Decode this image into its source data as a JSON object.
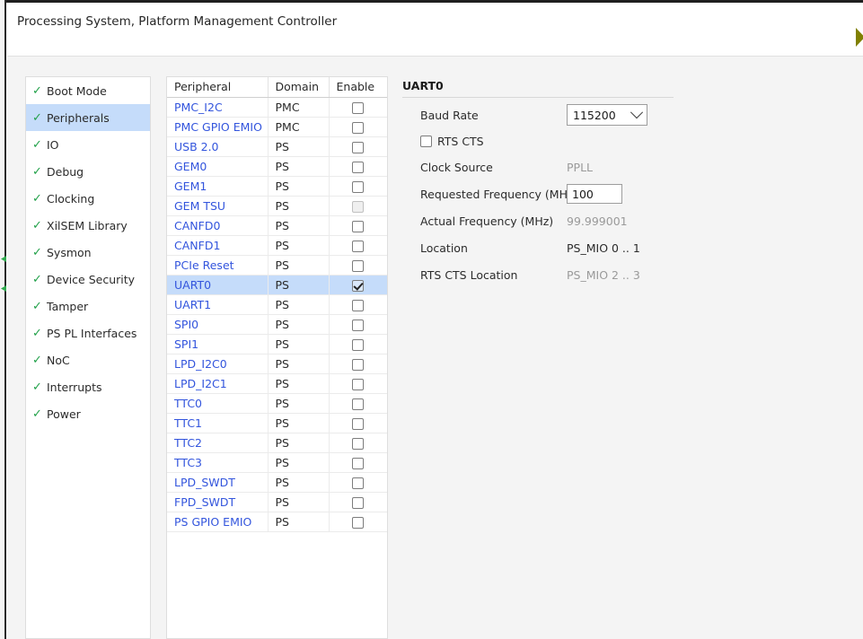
{
  "header": {
    "title": "Processing System, Platform Management Controller",
    "nav_arrow_icon": "arrow-right-icon",
    "nav_arrow_color": "#808000"
  },
  "sidebar": {
    "check_glyph": "✓",
    "items": [
      {
        "label": "Boot Mode",
        "selected": false
      },
      {
        "label": "Peripherals",
        "selected": true
      },
      {
        "label": "IO",
        "selected": false
      },
      {
        "label": "Debug",
        "selected": false
      },
      {
        "label": "Clocking",
        "selected": false
      },
      {
        "label": "XilSEM Library",
        "selected": false
      },
      {
        "label": "Sysmon",
        "selected": false
      },
      {
        "label": "Device Security",
        "selected": false
      },
      {
        "label": "Tamper",
        "selected": false
      },
      {
        "label": "PS PL Interfaces",
        "selected": false
      },
      {
        "label": "NoC",
        "selected": false
      },
      {
        "label": "Interrupts",
        "selected": false
      },
      {
        "label": "Power",
        "selected": false
      }
    ]
  },
  "table": {
    "columns": [
      "Peripheral",
      "Domain",
      "Enable"
    ],
    "rows": [
      {
        "peripheral": "PMC_I2C",
        "domain": "PMC",
        "enabled": false,
        "disabled": false,
        "selected": false
      },
      {
        "peripheral": "PMC GPIO EMIO",
        "domain": "PMC",
        "enabled": false,
        "disabled": false,
        "selected": false
      },
      {
        "peripheral": "USB 2.0",
        "domain": "PS",
        "enabled": false,
        "disabled": false,
        "selected": false
      },
      {
        "peripheral": "GEM0",
        "domain": "PS",
        "enabled": false,
        "disabled": false,
        "selected": false
      },
      {
        "peripheral": "GEM1",
        "domain": "PS",
        "enabled": false,
        "disabled": false,
        "selected": false
      },
      {
        "peripheral": "GEM TSU",
        "domain": "PS",
        "enabled": false,
        "disabled": true,
        "selected": false
      },
      {
        "peripheral": "CANFD0",
        "domain": "PS",
        "enabled": false,
        "disabled": false,
        "selected": false
      },
      {
        "peripheral": "CANFD1",
        "domain": "PS",
        "enabled": false,
        "disabled": false,
        "selected": false
      },
      {
        "peripheral": "PCIe Reset",
        "domain": "PS",
        "enabled": false,
        "disabled": false,
        "selected": false
      },
      {
        "peripheral": "UART0",
        "domain": "PS",
        "enabled": true,
        "disabled": false,
        "selected": true
      },
      {
        "peripheral": "UART1",
        "domain": "PS",
        "enabled": false,
        "disabled": false,
        "selected": false
      },
      {
        "peripheral": "SPI0",
        "domain": "PS",
        "enabled": false,
        "disabled": false,
        "selected": false
      },
      {
        "peripheral": "SPI1",
        "domain": "PS",
        "enabled": false,
        "disabled": false,
        "selected": false
      },
      {
        "peripheral": "LPD_I2C0",
        "domain": "PS",
        "enabled": false,
        "disabled": false,
        "selected": false
      },
      {
        "peripheral": "LPD_I2C1",
        "domain": "PS",
        "enabled": false,
        "disabled": false,
        "selected": false
      },
      {
        "peripheral": "TTC0",
        "domain": "PS",
        "enabled": false,
        "disabled": false,
        "selected": false
      },
      {
        "peripheral": "TTC1",
        "domain": "PS",
        "enabled": false,
        "disabled": false,
        "selected": false
      },
      {
        "peripheral": "TTC2",
        "domain": "PS",
        "enabled": false,
        "disabled": false,
        "selected": false
      },
      {
        "peripheral": "TTC3",
        "domain": "PS",
        "enabled": false,
        "disabled": false,
        "selected": false
      },
      {
        "peripheral": "LPD_SWDT",
        "domain": "PS",
        "enabled": false,
        "disabled": false,
        "selected": false
      },
      {
        "peripheral": "FPD_SWDT",
        "domain": "PS",
        "enabled": false,
        "disabled": false,
        "selected": false
      },
      {
        "peripheral": "PS GPIO EMIO",
        "domain": "PS",
        "enabled": false,
        "disabled": false,
        "selected": false
      }
    ]
  },
  "detail": {
    "title": "UART0",
    "baud_rate_label": "Baud Rate",
    "baud_rate_value": "115200",
    "baud_rate_options": [
      "115200"
    ],
    "rts_cts_label": "RTS CTS",
    "rts_cts_checked": false,
    "clock_source_label": "Clock Source",
    "clock_source_value": "PPLL",
    "requested_freq_label": "Requested Frequency (MHz)",
    "requested_freq_value": "100",
    "actual_freq_label": "Actual Frequency (MHz)",
    "actual_freq_value": "99.999001",
    "location_label": "Location",
    "location_value": "PS_MIO 0 .. 1",
    "rts_cts_location_label": "RTS CTS Location",
    "rts_cts_location_value": "PS_MIO 2 .. 3"
  },
  "colors": {
    "link": "#3355dd",
    "selection": "#c5dcfa",
    "check_green": "#22a14a",
    "muted": "#9a9a9a",
    "panel_bg": "#f4f4f4"
  }
}
